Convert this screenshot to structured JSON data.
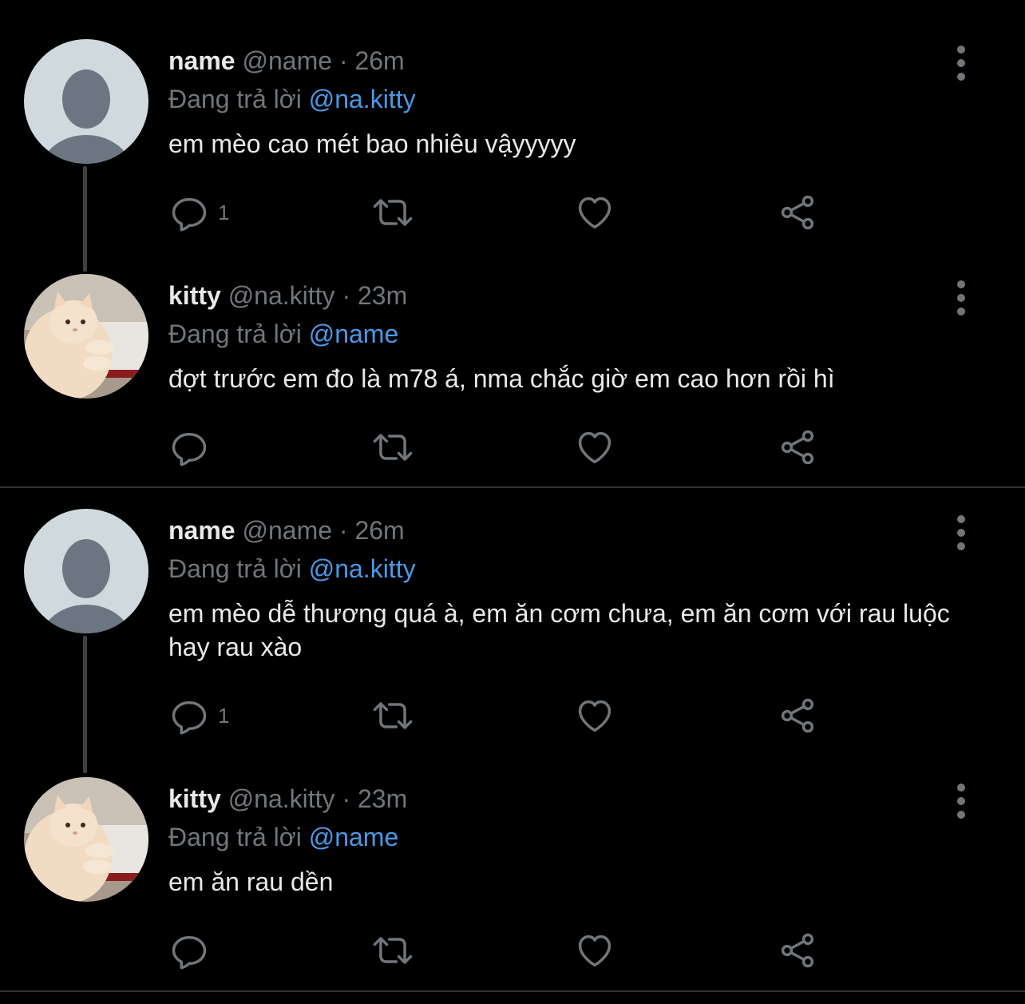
{
  "colors": {
    "background": "#000000",
    "text": "#e7e9ea",
    "muted": "#71767b",
    "mention": "#4a99e9",
    "divider": "#2f3336"
  },
  "threads": [
    {
      "tweets": [
        {
          "name": "name",
          "handle": "@name",
          "dot": "·",
          "time": "26m",
          "reply_prefix": "Đang trả lời",
          "reply_to": "@na.kitty",
          "text": "em mèo cao mét bao nhiêu vậyyyyy",
          "reply_count": "1",
          "avatar": "default-avatar"
        },
        {
          "name": "kitty",
          "handle": "@na.kitty",
          "dot": "·",
          "time": "23m",
          "reply_prefix": "Đang trả lời",
          "reply_to": "@name",
          "text": "đợt trước em đo là m78 á, nma chắc giờ em cao hơn rồi hì",
          "reply_count": "",
          "avatar": "cat-photo-avatar"
        }
      ]
    },
    {
      "tweets": [
        {
          "name": "name",
          "handle": "@name",
          "dot": "·",
          "time": "26m",
          "reply_prefix": "Đang trả lời",
          "reply_to": "@na.kitty",
          "text": "em mèo dễ thương quá à, em ăn cơm chưa, em ăn cơm với rau luộc hay rau xào",
          "reply_count": "1",
          "avatar": "default-avatar"
        },
        {
          "name": "kitty",
          "handle": "@na.kitty",
          "dot": "·",
          "time": "23m",
          "reply_prefix": "Đang trả lời",
          "reply_to": "@name",
          "text": "em ăn rau dền",
          "reply_count": "",
          "avatar": "cat-photo-avatar"
        }
      ]
    }
  ],
  "icons": {
    "reply": "reply-bubble-icon",
    "retweet": "retweet-icon",
    "like": "heart-icon",
    "share": "share-icon",
    "more": "more-vertical-icon"
  }
}
